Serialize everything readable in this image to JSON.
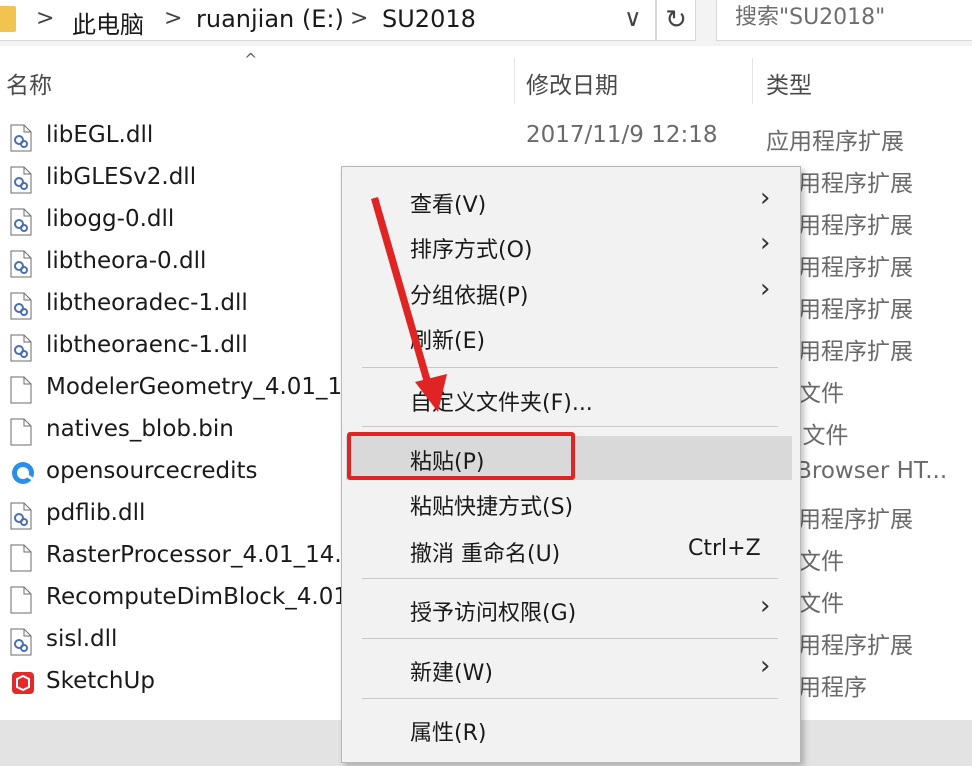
{
  "address_bar": {
    "breadcrumbs": [
      "此电脑",
      "ruanjian (E:)",
      "SU2018"
    ],
    "separator": ">",
    "dropdown_glyph": "∨",
    "refresh_glyph": "↻",
    "search_placeholder": "搜索\"SU2018\""
  },
  "columns": {
    "name": "名称",
    "date": "修改日期",
    "type": "类型",
    "sort_glyph": "^"
  },
  "files": [
    {
      "name": "libEGL.dll",
      "date": "2017/11/9 12:18",
      "type": "应用程序扩展",
      "icon": "dll-file-icon"
    },
    {
      "name": "libGLESv2.dll",
      "date": "",
      "type": "用程序扩展",
      "icon": "dll-file-icon"
    },
    {
      "name": "libogg-0.dll",
      "date": "",
      "type": "用程序扩展",
      "icon": "dll-file-icon"
    },
    {
      "name": "libtheora-0.dll",
      "date": "",
      "type": "用程序扩展",
      "icon": "dll-file-icon"
    },
    {
      "name": "libtheoradec-1.dll",
      "date": "",
      "type": "用程序扩展",
      "icon": "dll-file-icon"
    },
    {
      "name": "libtheoraenc-1.dll",
      "date": "",
      "type": "用程序扩展",
      "icon": "dll-file-icon"
    },
    {
      "name": "ModelerGeometry_4.01_1",
      "date": "",
      "type": "文件",
      "icon": "blank-file-icon"
    },
    {
      "name": "natives_blob.bin",
      "date": "",
      "type": "N 文件",
      "icon": "blank-file-icon"
    },
    {
      "name": "opensourcecredits",
      "date": "",
      "type": "QBrowser HT...",
      "icon": "browser-file-icon"
    },
    {
      "name": "pdflib.dll",
      "date": "",
      "type": "用程序扩展",
      "icon": "dll-file-icon"
    },
    {
      "name": "RasterProcessor_4.01_14.",
      "date": "",
      "type": "文件",
      "icon": "blank-file-icon"
    },
    {
      "name": "RecomputeDimBlock_4.01",
      "date": "",
      "type": "文件",
      "icon": "blank-file-icon"
    },
    {
      "name": "sisl.dll",
      "date": "",
      "type": "用程序扩展",
      "icon": "dll-file-icon"
    },
    {
      "name": "SketchUp",
      "date": "",
      "type": "用程序",
      "icon": "sketchup-app-icon"
    }
  ],
  "context_menu": {
    "items": [
      {
        "label": "查看(V)",
        "submenu": true
      },
      {
        "label": "排序方式(O)",
        "submenu": true
      },
      {
        "label": "分组依据(P)",
        "submenu": true
      },
      {
        "label": "刷新(E)",
        "submenu": false
      },
      {
        "label": "自定义文件夹(F)...",
        "submenu": false
      },
      {
        "label": "粘贴(P)",
        "submenu": false,
        "highlighted": true
      },
      {
        "label": "粘贴快捷方式(S)",
        "submenu": false
      },
      {
        "label": "撤消 重命名(U)",
        "submenu": false,
        "shortcut": "Ctrl+Z"
      },
      {
        "label": "授予访问权限(G)",
        "submenu": true
      },
      {
        "label": "新建(W)",
        "submenu": true
      },
      {
        "label": "属性(R)",
        "submenu": false
      }
    ],
    "submenu_glyph": "›"
  },
  "colors": {
    "annotation_red": "#e02424",
    "menu_bg": "#f2f2f2",
    "highlight_bg": "#d9d9d9",
    "folder_yellow": "#f3c34f"
  }
}
